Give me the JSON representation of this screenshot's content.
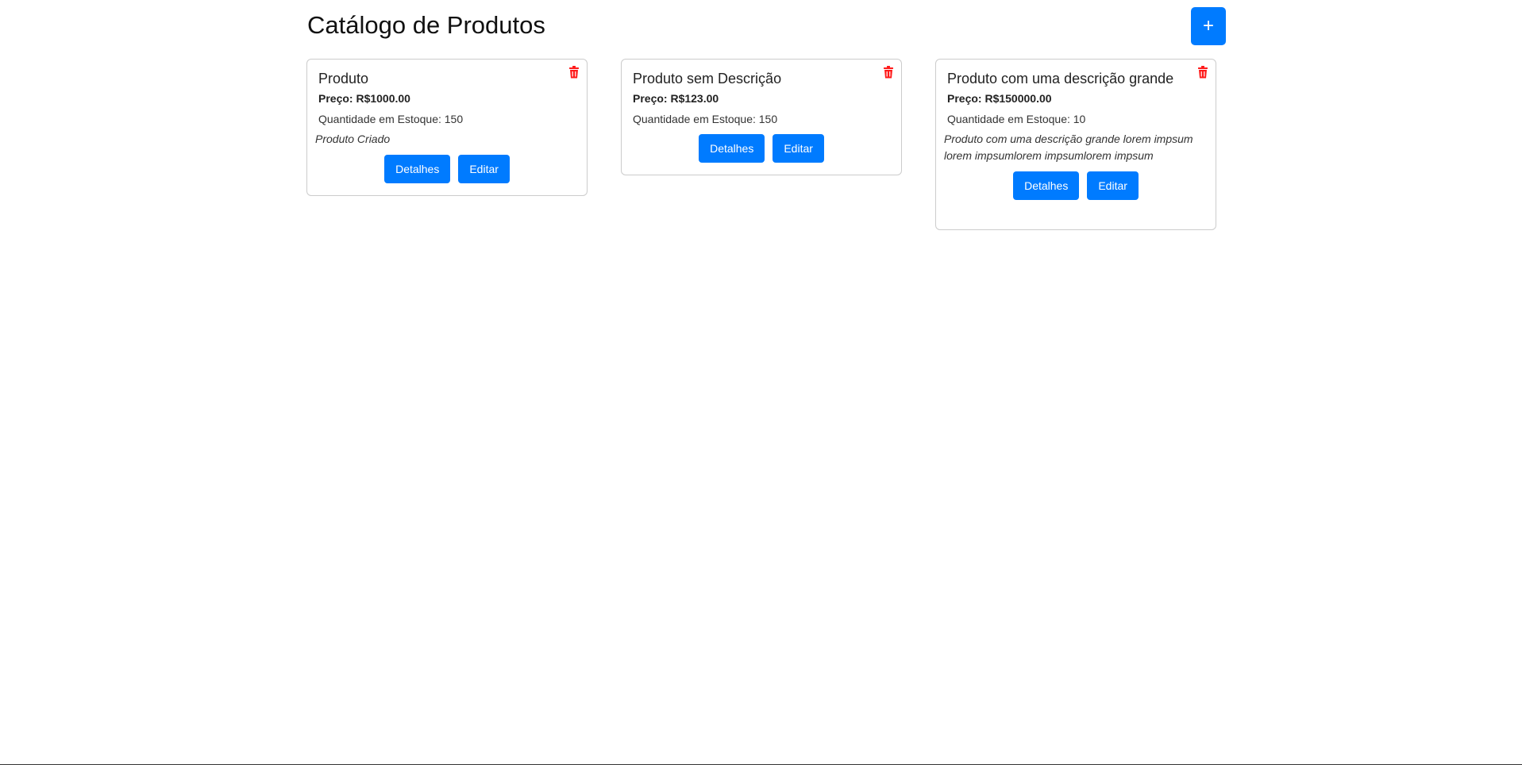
{
  "header": {
    "title": "Catálogo de Produtos",
    "add_label": "+"
  },
  "colors": {
    "primary": "#007bff",
    "danger": "#ff1a1a",
    "border": "#cccccc"
  },
  "products": [
    {
      "name": "Produto",
      "price": "Preço: R$1000.00",
      "stock": "Quantidade em Estoque: 150",
      "description": "Produto Criado",
      "details_label": "Detalhes",
      "edit_label": "Editar",
      "delete_icon": "trash-icon"
    },
    {
      "name": "Produto sem Descrição",
      "price": "Preço: R$123.00",
      "stock": "Quantidade em Estoque: 150",
      "description": "",
      "details_label": "Detalhes",
      "edit_label": "Editar",
      "delete_icon": "trash-icon"
    },
    {
      "name": "Produto com uma descrição grande",
      "price": "Preço: R$150000.00",
      "stock": "Quantidade em Estoque: 10",
      "description": "Produto com uma descrição grande lorem impsum lorem impsumlorem impsumlorem impsum",
      "details_label": "Detalhes",
      "edit_label": "Editar",
      "delete_icon": "trash-icon"
    }
  ]
}
